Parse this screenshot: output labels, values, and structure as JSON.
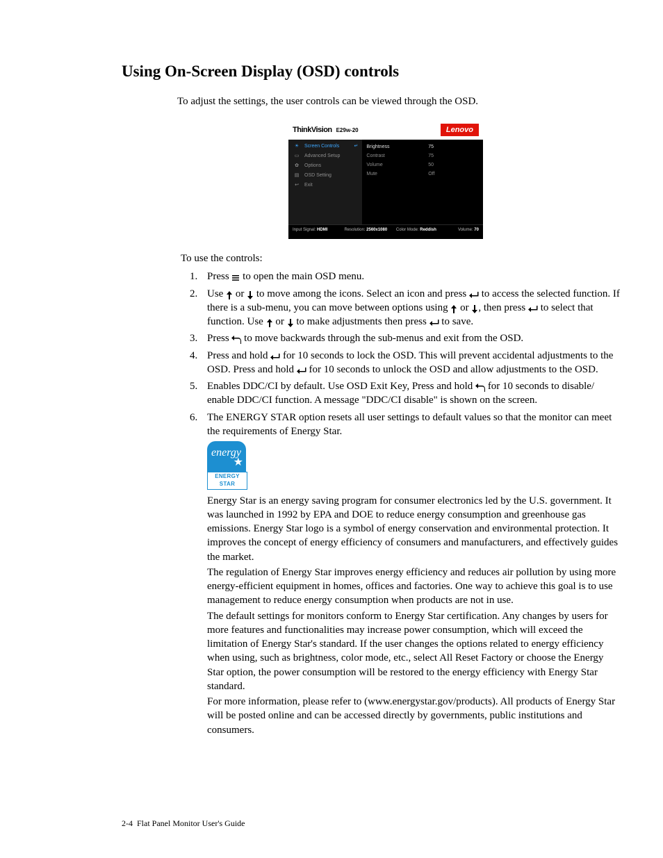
{
  "page": {
    "title": "Using On-Screen Display (OSD) controls",
    "intro": "To adjust the settings, the user controls can be viewed through the OSD.",
    "lead": "To use the controls:"
  },
  "osd": {
    "brand": "ThinkVision",
    "model": "E29w-20",
    "logo": "Lenovo",
    "menu": [
      {
        "icon": "☀",
        "label": "Screen Controls",
        "active": true
      },
      {
        "icon": "▭",
        "label": "Advanced Setup"
      },
      {
        "icon": "✿",
        "label": "Options"
      },
      {
        "icon": "▤",
        "label": "OSD Setting"
      },
      {
        "icon": "↩",
        "label": "Exit"
      }
    ],
    "settings": [
      {
        "label": "Brightness",
        "value": "75"
      },
      {
        "label": "Contrast",
        "value": "75"
      },
      {
        "label": "Volume",
        "value": "50"
      },
      {
        "label": "Mute",
        "value": "Off"
      }
    ],
    "status": {
      "input_label": "Input Signal:",
      "input_value": "HDMI",
      "res_label": "Resolution:",
      "res_value": "2560x1080",
      "color_label": "Color Mode:",
      "color_value": "Reddish",
      "vol_label": "Volume:",
      "vol_value": "70"
    }
  },
  "steps": {
    "s1a": "Press ",
    "s1b": " to open the main OSD menu.",
    "s2a": "Use ",
    "s2b": " or ",
    "s2c": " to move among the icons. Select an icon and press ",
    "s2d": " to access the selected function. If there is a sub-menu, you can move between options using ",
    "s2e": " or ",
    "s2f": ", then press ",
    "s2g": " to select that function. Use ",
    "s2h": " or ",
    "s2i": " to make adjustments then press ",
    "s2j": " to save.",
    "s3a": "Press ",
    "s3b": " to move backwards through the sub-menus and exit from the OSD.",
    "s4a": "Press and hold ",
    "s4b": " for 10 seconds to lock the OSD. This will prevent accidental adjustments to the OSD. Press and hold ",
    "s4c": " for 10 seconds to unlock the OSD and allow adjustments to the OSD.",
    "s5a": "Enables DDC/CI by default. Use OSD Exit Key, Press and hold ",
    "s5b": " for 10 seconds to disable/ enable DDC/CI function. A message \"DDC/CI disable\" is shown on the screen.",
    "s6": "The ENERGY STAR option resets all user settings to default values so that the monitor can meet the requirements of Energy Star."
  },
  "energystar": {
    "logo_label": "ENERGY STAR",
    "p1": "Energy Star is an energy saving program for consumer electronics led by the U.S. government. It was launched in 1992 by EPA and DOE to reduce energy consumption and greenhouse gas emissions. Energy Star logo is a symbol of energy conservation and environmental protection. It improves the concept of energy efficiency of consumers and manufacturers, and effectively guides the market.",
    "p2": "The regulation of Energy Star improves energy efficiency and reduces air pollution by using more energy-efficient equipment in homes, offices and factories. One way to achieve this goal is to use management to reduce energy consumption when products are not in use.",
    "p3": "The default settings for monitors conform to Energy Star certification. Any changes by users for more features and functionalities may increase power consumption, which will exceed the limitation of Energy Star's standard. If the user changes the options related to energy efficiency when using, such as brightness, color mode, etc., select All Reset Factory or choose the Energy Star option, the power consumption will be restored to the energy efficiency with Energy Star standard.",
    "p4": "For more information, please refer to (www.energystar.gov/products). All products of Energy Star will be posted online and can be accessed directly by governments, public institutions and consumers."
  },
  "footer": {
    "page_num": "2-4",
    "book": "Flat Panel Monitor User's Guide"
  },
  "icons": {
    "menu": "☰",
    "up": "↑",
    "down": "↓",
    "enter": "↵",
    "back": "↶"
  }
}
